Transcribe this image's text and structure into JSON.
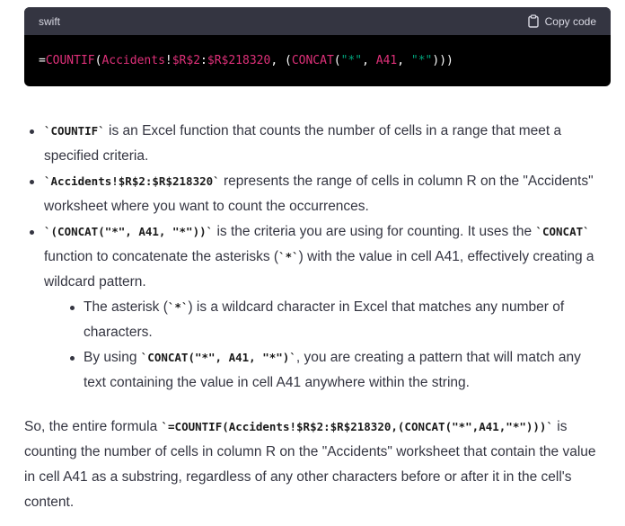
{
  "code_block": {
    "language": "swift",
    "copy_label": "Copy code",
    "tokens": [
      {
        "text": "=",
        "cls": "t-white"
      },
      {
        "text": "COUNTIF",
        "cls": "t-red"
      },
      {
        "text": "(",
        "cls": "t-white"
      },
      {
        "text": "Accidents",
        "cls": "t-red"
      },
      {
        "text": "!",
        "cls": "t-white"
      },
      {
        "text": "$R$2",
        "cls": "t-red"
      },
      {
        "text": ":",
        "cls": "t-white"
      },
      {
        "text": "$R$218320",
        "cls": "t-red"
      },
      {
        "text": ", (",
        "cls": "t-white"
      },
      {
        "text": "CONCAT",
        "cls": "t-red"
      },
      {
        "text": "(",
        "cls": "t-white"
      },
      {
        "text": "\"*\"",
        "cls": "t-green"
      },
      {
        "text": ", ",
        "cls": "t-white"
      },
      {
        "text": "A41",
        "cls": "t-red"
      },
      {
        "text": ", ",
        "cls": "t-white"
      },
      {
        "text": "\"*\"",
        "cls": "t-green"
      },
      {
        "text": ")))",
        "cls": "t-white"
      }
    ]
  },
  "bullets": [
    {
      "code": "`COUNTIF`",
      "text": " is an Excel function that counts the number of cells in a range that meet a specified criteria."
    },
    {
      "code": "`Accidents!$R$2:$R$218320`",
      "text": " represents the range of cells in column R on the \"Accidents\" worksheet where you want to count the occurrences."
    },
    {
      "code": "`(CONCAT(\"*\", A41, \"*\"))`",
      "text_a": " is the criteria you are using for counting. It uses the ",
      "code2": "`CONCAT`",
      "text_b": " function to concatenate the asterisks (",
      "code3": "`*`",
      "text_c": ") with the value in cell A41, effectively creating a wildcard pattern."
    }
  ],
  "sub_bullets": [
    {
      "text_a": "The asterisk (",
      "code": "`*`",
      "text_b": ") is a wildcard character in Excel that matches any number of characters."
    },
    {
      "text_a": "By using ",
      "code": "`CONCAT(\"*\", A41, \"*\")`",
      "text_b": ", you are creating a pattern that will match any text containing the value in cell A41 anywhere within the string."
    }
  ],
  "summary": {
    "text_a": "So, the entire formula ",
    "code": "`=COUNTIF(Accidents!$R$2:$R$218320,(CONCAT(\"*\",A41,\"*\")))`",
    "text_b": " is counting the number of cells in column R on the \"Accidents\" worksheet that contain the value in cell A41 as a substring, regardless of any other characters before or after it in the cell's content."
  }
}
